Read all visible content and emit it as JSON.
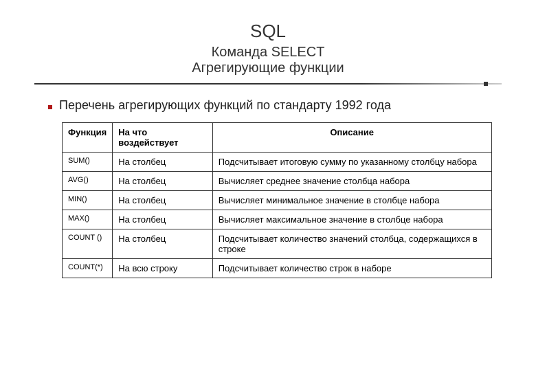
{
  "title": "SQL",
  "subtitle1": "Команда SELECT",
  "subtitle2": "Агрегирующие функции",
  "bullet": "Перечень агрегирующих функций по стандарту 1992 года",
  "table": {
    "headers": [
      "Функция",
      "На что воздействует",
      "Описание"
    ],
    "rows": [
      {
        "fn": "SUM()",
        "target": "На столбец",
        "desc": "Подсчитывает итоговую сумму по указанному столбцу набора"
      },
      {
        "fn": "AVG()",
        "target": "На столбец",
        "desc": "Вычисляет среднее значение столбца набора"
      },
      {
        "fn": "MIN()",
        "target": "На столбец",
        "desc": "Вычисляет минимальное значение в столбце набора"
      },
      {
        "fn": "MAX()",
        "target": "На столбец",
        "desc": "Вычисляет максимальное значение в столбце набора"
      },
      {
        "fn": "COUNT ()",
        "target": "На столбец",
        "desc": "Подсчитывает количество значений столбца, содержащихся в строке"
      },
      {
        "fn": "COUNT(*)",
        "target": "На всю строку",
        "desc": "Подсчитывает количество строк в наборе"
      }
    ]
  }
}
